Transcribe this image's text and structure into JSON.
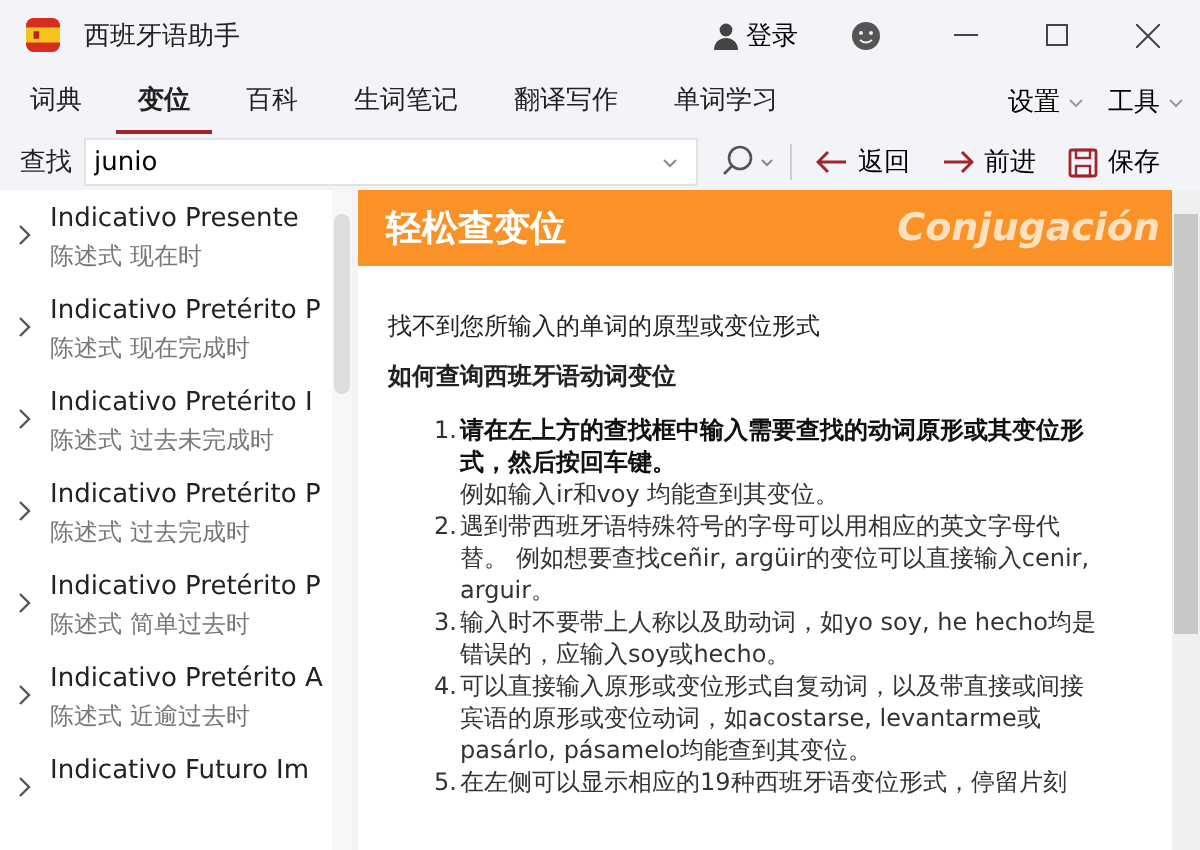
{
  "window": {
    "title": "西班牙语助手",
    "login": "登录"
  },
  "tabs": [
    {
      "label": "词典",
      "selected": false
    },
    {
      "label": "变位",
      "selected": true
    },
    {
      "label": "百科",
      "selected": false
    },
    {
      "label": "生词笔记",
      "selected": false
    },
    {
      "label": "翻译写作",
      "selected": false
    },
    {
      "label": "单词学习",
      "selected": false
    }
  ],
  "menus": [
    "设置",
    "工具"
  ],
  "search": {
    "label": "查找",
    "value": "junio"
  },
  "actions": [
    {
      "kind": "back",
      "label": "返回"
    },
    {
      "kind": "forward",
      "label": "前进"
    },
    {
      "kind": "save",
      "label": "保存"
    }
  ],
  "tenses": [
    {
      "name": "Indicativo Presente",
      "desc": "陈述式 现在时"
    },
    {
      "name": "Indicativo Pretérito P",
      "desc": "陈述式 现在完成时"
    },
    {
      "name": "Indicativo Pretérito I",
      "desc": "陈述式 过去未完成时"
    },
    {
      "name": "Indicativo Pretérito P",
      "desc": "陈述式 过去完成时"
    },
    {
      "name": "Indicativo Pretérito P",
      "desc": "陈述式 简单过去时"
    },
    {
      "name": "Indicativo Pretérito A",
      "desc": "陈述式 近逾过去时"
    },
    {
      "name": "Indicativo Futuro Im"
    }
  ],
  "content": {
    "banner": "轻松查变位",
    "banner_sub": "Conjugación",
    "message": "找不到您所输入的单词的原型或变位形式",
    "heading": "如何查询西班牙语动词变位",
    "steps": [
      {
        "number": "1.",
        "text": "请在左上方的查找框中输入需要查找的动词原形或其变位形式，然后按回车键。",
        "emphasis": true,
        "note": "例如输入ir和voy 均能查到其变位。"
      },
      {
        "number": "2.",
        "text": "遇到带西班牙语特殊符号的字母可以用相应的英文字母代替。 例如想要查找ceñir, argüir的变位可以直接输入cenir, arguir。",
        "emphasis": false
      },
      {
        "number": "3.",
        "text": "输入时不要带上人称以及助动词，如yo soy, he hecho均是错误的，应输入soy或hecho。",
        "emphasis": false
      },
      {
        "number": "4.",
        "text": "可以直接输入原形或变位形式自复动词，以及带直接或间接宾语的原形或变位动词，如acostarse, levantarme或pasárlo, pásamelo均能查到其变位。",
        "emphasis": false
      },
      {
        "number": "5.",
        "text": "在左侧可以显示相应的19种西班牙语变位形式，停留片刻",
        "emphasis": false
      }
    ]
  }
}
